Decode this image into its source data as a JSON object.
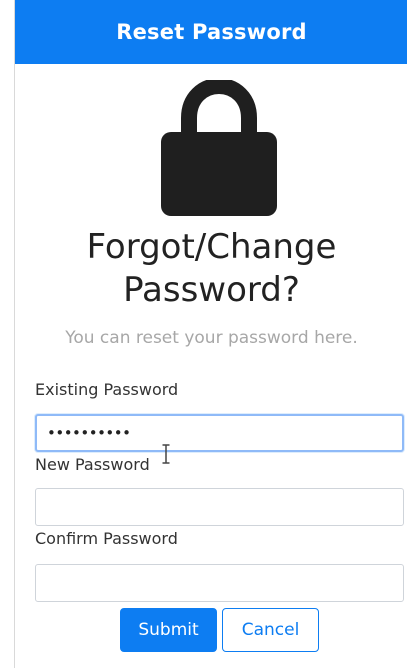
{
  "header": {
    "title": "Reset Password"
  },
  "icons": {
    "lock": "lock-icon"
  },
  "main": {
    "title_line1": "Forgot/Change",
    "title_line2": "Password?",
    "subtitle": "You can reset your password here."
  },
  "form": {
    "existing_password": {
      "label": "Existing Password",
      "value": "••••••••••"
    },
    "new_password": {
      "label": "New Password",
      "value": ""
    },
    "confirm_password": {
      "label": "Confirm Password",
      "value": ""
    }
  },
  "buttons": {
    "submit": "Submit",
    "cancel": "Cancel"
  },
  "colors": {
    "primary": "#0d7df2",
    "title_text": "#222222",
    "subtitle_text": "#a7a7a7"
  }
}
